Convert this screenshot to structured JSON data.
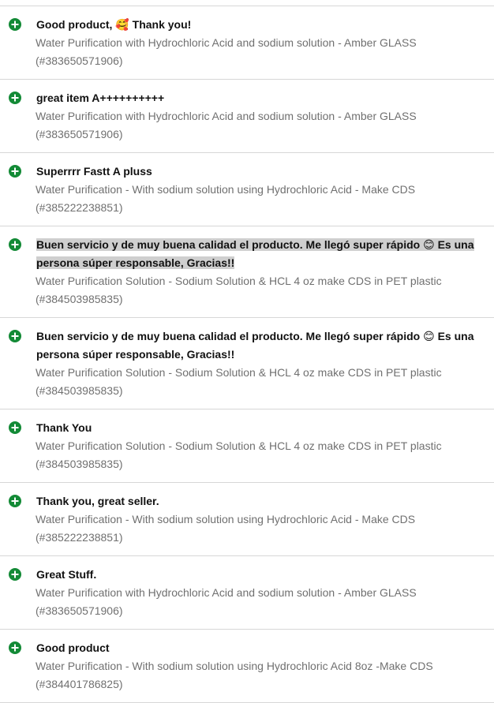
{
  "feedback": [
    {
      "comment": "Good product, 🥰 Thank you!",
      "item_title": "Water Purification with Hydrochloric Acid and sodium solution - Amber GLASS",
      "item_id": "(#383650571906)",
      "rating": "positive",
      "highlighted": false
    },
    {
      "comment": "great item A++++++++++",
      "item_title": "Water Purification with Hydrochloric Acid and sodium solution - Amber GLASS",
      "item_id": "(#383650571906)",
      "rating": "positive",
      "highlighted": false
    },
    {
      "comment": "Superrrr Fastt A pluss",
      "item_title": "Water Purification - With sodium solution using Hydrochloric Acid - Make CDS",
      "item_id": "(#385222238851)",
      "rating": "positive",
      "highlighted": false
    },
    {
      "comment": "Buen servicio y de muy buena calidad el producto. Me llegó super rápido 😊 Es una persona súper responsable, Gracias!!",
      "item_title": "Water Purification Solution - Sodium Solution & HCL 4 oz make CDS in PET plastic",
      "item_id": "(#384503985835)",
      "rating": "positive",
      "highlighted": true
    },
    {
      "comment": "Buen servicio y de muy buena calidad el producto. Me llegó super rápido 😊 Es una persona súper responsable, Gracias!!",
      "item_title": "Water Purification Solution - Sodium Solution & HCL 4 oz make CDS in PET plastic",
      "item_id": "(#384503985835)",
      "rating": "positive",
      "highlighted": false
    },
    {
      "comment": "Thank You",
      "item_title": "Water Purification Solution - Sodium Solution & HCL 4 oz make CDS in PET plastic",
      "item_id": "(#384503985835)",
      "rating": "positive",
      "highlighted": false
    },
    {
      "comment": "Thank you, great seller.",
      "item_title": "Water Purification - With sodium solution using Hydrochloric Acid - Make CDS",
      "item_id": "(#385222238851)",
      "rating": "positive",
      "highlighted": false
    },
    {
      "comment": "Great Stuff.",
      "item_title": "Water Purification with Hydrochloric Acid and sodium solution - Amber GLASS",
      "item_id": "(#383650571906)",
      "rating": "positive",
      "highlighted": false
    },
    {
      "comment": "Good product",
      "item_title": "Water Purification - With sodium solution using Hydrochloric Acid 8oz -Make CDS",
      "item_id": "(#384401786825)",
      "rating": "positive",
      "highlighted": false
    }
  ],
  "icons": {
    "positive": "plus-circle-icon"
  },
  "colors": {
    "positive_icon": "#138a36",
    "item_text": "#707070",
    "highlight": "#cfcfcf",
    "divider": "#d7d7d7"
  }
}
